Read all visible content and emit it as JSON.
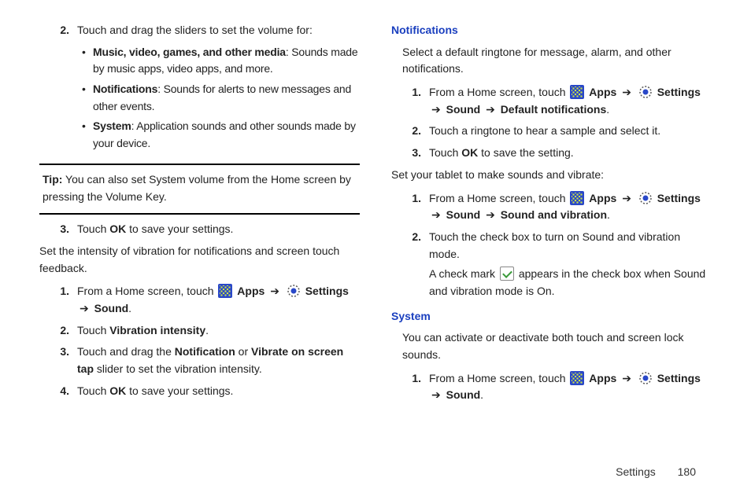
{
  "left": {
    "step2_lead": "Touch and drag the sliders to set the volume for:",
    "bullets": {
      "b1_bold": "Music, video, games, and other media",
      "b1_rest": ": Sounds made by music apps, video apps, and more.",
      "b2_bold": "Notifications",
      "b2_rest": ": Sounds for alerts to new messages and other events.",
      "b3_bold": "System",
      "b3_rest": ": Application sounds and other sounds made by your device."
    },
    "tip_label": "Tip:",
    "tip_text": " You can also set System volume from the Home screen by pressing the Volume Key.",
    "step3_pre": "Touch ",
    "step3_bold": "OK",
    "step3_post": " to save your settings.",
    "vibe_intro": "Set the intensity of vibration for notifications and screen touch feedback.",
    "v1_pre": "From a Home screen, touch ",
    "apps_label": " Apps ",
    "settings_label": " Settings ",
    "sound_label": "Sound",
    "v2_pre": "Touch ",
    "v2_bold": "Vibration intensity",
    "v3_pre": "Touch and drag the ",
    "v3_b1": "Notification",
    "v3_mid": " or ",
    "v3_b2": "Vibrate on screen tap",
    "v3_post": " slider to set the vibration intensity.",
    "v4_pre": "Touch ",
    "v4_bold": "OK",
    "v4_post": " to save your settings."
  },
  "right": {
    "notif_heading": "Notifications",
    "notif_intro": "Select a default ringtone for message, alarm, and other notifications.",
    "n1_pre": "From a Home screen, touch ",
    "apps_label": " Apps ",
    "settings_label": " Settings ",
    "sound_label": "Sound",
    "defnotif_label": "Default notifications",
    "n2": "Touch a ringtone to hear a sample and select it.",
    "n3_pre": "Touch ",
    "n3_bold": "OK",
    "n3_post": " to save the setting.",
    "sv_intro": "Set your tablet to make sounds and vibrate:",
    "sv1_pre": "From a Home screen, touch ",
    "sv_sav_label": "Sound and vibration",
    "sv2": "Touch the check box to turn on Sound and vibration mode.",
    "sv2b_pre": "A check mark ",
    "sv2b_post": " appears in the check box when Sound and vibration mode is On.",
    "sys_heading": "System",
    "sys_intro": "You can activate or deactivate both touch and screen lock sounds.",
    "sy1_pre": "From a Home screen, touch "
  },
  "arrow": "➔",
  "nums": {
    "n1": "1.",
    "n2": "2.",
    "n3": "3.",
    "n4": "4."
  },
  "bullet": "•",
  "footer": {
    "section": "Settings",
    "page": "180"
  }
}
